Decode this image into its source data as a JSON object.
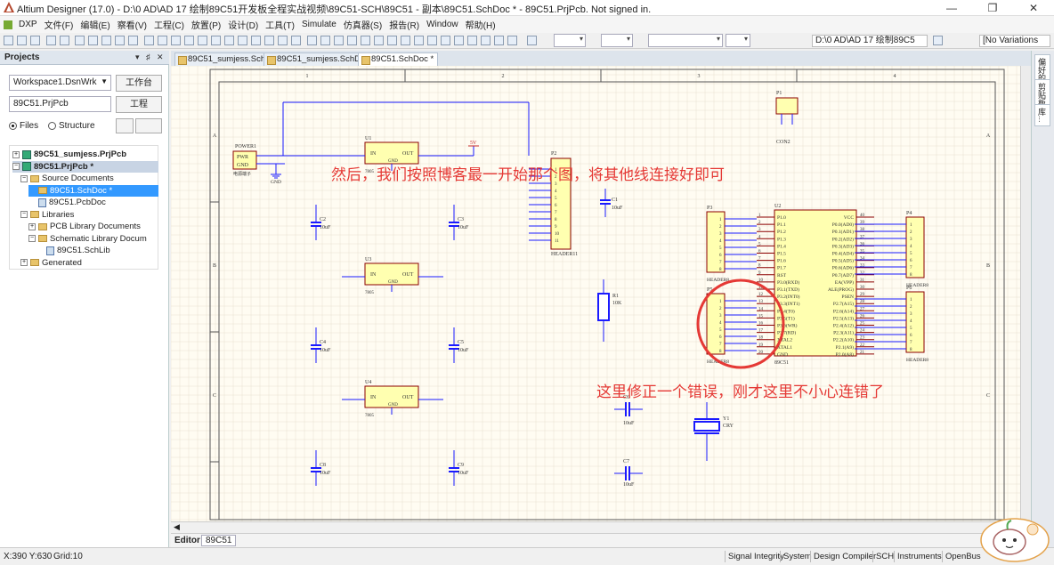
{
  "window": {
    "title": "Altium Designer (17.0) - D:\\0 AD\\AD 17 绘制89C51开发板全程实战视频\\89C51-SCH\\89C51 - 副本\\89C51.SchDoc * - 89C51.PrjPcb. Not signed in.",
    "minimize": "—",
    "maximize": "❐",
    "close": "✕"
  },
  "menu": [
    "DXP",
    "文件(F)",
    "编辑(E)",
    "察看(V)",
    "工程(C)",
    "放置(P)",
    "设计(D)",
    "工具(T)",
    "Simulate",
    "仿真器(S)",
    "报告(R)",
    "Window",
    "帮助(H)"
  ],
  "toolbar": {
    "path_field": "D:\\0 AD\\AD 17 绘制89C5",
    "variations": "[No Variations"
  },
  "projects": {
    "title": "Projects",
    "controls": [
      "▾",
      "♯",
      "✕"
    ],
    "workspace": "Workspace1.DsnWrk",
    "workspace_btn": "工作台",
    "project": "89C51.PrjPcb",
    "project_btn": "工程",
    "radio_files": "Files",
    "radio_structure": "Structure",
    "tree": [
      {
        "label": "89C51_sumjess.PrjPcb",
        "level": 0,
        "exp": "+",
        "icon": "prj",
        "bold": true
      },
      {
        "label": "89C51.PrjPcb *",
        "level": 0,
        "exp": "−",
        "icon": "prj",
        "bold": true,
        "highlight": true
      },
      {
        "label": "Source Documents",
        "level": 1,
        "exp": "−",
        "icon": "fld"
      },
      {
        "label": "89C51.SchDoc *",
        "level": 2,
        "exp": "",
        "icon": "fld",
        "selected": true
      },
      {
        "label": "89C51.PcbDoc",
        "level": 2,
        "exp": "",
        "icon": "doc"
      },
      {
        "label": "Libraries",
        "level": 1,
        "exp": "−",
        "icon": "fld"
      },
      {
        "label": "PCB Library Documents",
        "level": 2,
        "exp": "+",
        "icon": "fld"
      },
      {
        "label": "Schematic Library Docum",
        "level": 2,
        "exp": "−",
        "icon": "fld"
      },
      {
        "label": "89C51.SchLib",
        "level": 3,
        "exp": "",
        "icon": "doc"
      },
      {
        "label": "Generated",
        "level": 1,
        "exp": "+",
        "icon": "fld"
      }
    ]
  },
  "doc_tabs": [
    {
      "label": "89C51_sumjess.SchLib",
      "active": false
    },
    {
      "label": "89C51_sumjess.SchDoc",
      "active": false
    },
    {
      "label": "89C51.SchDoc *",
      "active": true
    }
  ],
  "right_tabs": [
    "偏好的",
    "剪贴板",
    "库..."
  ],
  "schematic": {
    "col_labels": [
      "1",
      "2",
      "3",
      "4"
    ],
    "row_labels": [
      "A",
      "B",
      "C"
    ],
    "annotation1": "然后，我们按照博客最一开始那个图，将其他线连接好即可",
    "annotation2": "这里修正一个错误，刚才这里不小心连错了",
    "power1": {
      "ref": "POWER1",
      "pwr": "PWR",
      "gnd": "GND",
      "note": "电源端子"
    },
    "gnd_label": "GND",
    "vcc_label": "5V",
    "regulators": [
      {
        "ref": "U1",
        "name": "7805",
        "in": "IN",
        "out": "OUT",
        "gnd": "GND"
      },
      {
        "ref": "U3",
        "name": "7805",
        "in": "IN",
        "out": "OUT",
        "gnd": "GND"
      },
      {
        "ref": "U4",
        "name": "7805",
        "in": "IN",
        "out": "OUT",
        "gnd": "GND"
      }
    ],
    "caps": [
      {
        "ref": "C2",
        "val": "10uF"
      },
      {
        "ref": "C3",
        "val": "10uF"
      },
      {
        "ref": "C4",
        "val": "10uF"
      },
      {
        "ref": "C5",
        "val": "10uF"
      },
      {
        "ref": "C8",
        "val": "10uF"
      },
      {
        "ref": "C9",
        "val": "10uF"
      },
      {
        "ref": "C1",
        "val": "10uF"
      },
      {
        "ref": "C6",
        "val": "10uF"
      },
      {
        "ref": "C7",
        "val": "10uF"
      }
    ],
    "header11": {
      "ref": "P2",
      "name": "HEADER11",
      "pins": [
        "1",
        "2",
        "3",
        "4",
        "5",
        "6",
        "7",
        "8",
        "9",
        "10",
        "11"
      ]
    },
    "con2": {
      "ref": "P1",
      "name": "CON2"
    },
    "r1": {
      "ref": "R1",
      "val": "10K"
    },
    "y1": {
      "ref": "Y1",
      "val": "CRY"
    },
    "mcu": {
      "ref": "U2",
      "name": "89C51",
      "left_pins": [
        "P1.0",
        "P1.1",
        "P1.2",
        "P1.3",
        "P1.4",
        "P1.5",
        "P1.6",
        "P1.7",
        "RST",
        "P3.0(RXD)",
        "P3.1(TXD)",
        "P3.2(INT0)",
        "P3.3(INT1)",
        "P3.4(T0)",
        "P3.5(T1)",
        "P3.6(WR)",
        "P3.7(RD)",
        "XTAL2",
        "XTAL1",
        "GND"
      ],
      "left_nums": [
        "1",
        "2",
        "3",
        "4",
        "5",
        "6",
        "7",
        "8",
        "9",
        "10",
        "11",
        "12",
        "13",
        "14",
        "15",
        "16",
        "17",
        "18",
        "19",
        "20"
      ],
      "right_pins": [
        "VCC",
        "P0.0(AD0)",
        "P0.1(AD1)",
        "P0.2(AD2)",
        "P0.3(AD3)",
        "P0.4(AD4)",
        "P0.5(AD5)",
        "P0.6(AD6)",
        "P0.7(AD7)",
        "EA(VPP)",
        "ALE(PROG)",
        "PSEN",
        "P2.7(A15)",
        "P2.6(A14)",
        "P2.5(A13)",
        "P2.4(A12)",
        "P2.3(A11)",
        "P2.2(A10)",
        "P2.1(A9)",
        "P2.0(A8)"
      ],
      "right_nums": [
        "40",
        "39",
        "38",
        "37",
        "36",
        "35",
        "34",
        "33",
        "32",
        "31",
        "30",
        "29",
        "28",
        "27",
        "26",
        "25",
        "24",
        "23",
        "22",
        "21"
      ]
    },
    "headers8": [
      {
        "ref": "P3",
        "name": "HEADER8"
      },
      {
        "ref": "P5",
        "name": "HEADER8"
      },
      {
        "ref": "P4",
        "name": "HEADER8"
      },
      {
        "ref": "P6",
        "name": "HEADER8"
      }
    ],
    "header8_pins": [
      "1",
      "2",
      "3",
      "4",
      "5",
      "6",
      "7",
      "8"
    ]
  },
  "editor": {
    "label": "Editor",
    "tab": "89C51"
  },
  "status": {
    "coords": "X:390 Y:630",
    "grid": "Grid:10",
    "panels": [
      "Signal Integrity",
      "System",
      "Design Compiler",
      "SCH",
      "Instruments",
      "OpenBus"
    ]
  },
  "colors": {
    "wire": "#1a1aff",
    "component_fill": "#ffffb0",
    "component_border": "#8b0000",
    "annotation": "#e53935",
    "circle": "#e53935",
    "sheet_bg": "#fffcf2",
    "grid": "#e8e0d0"
  }
}
